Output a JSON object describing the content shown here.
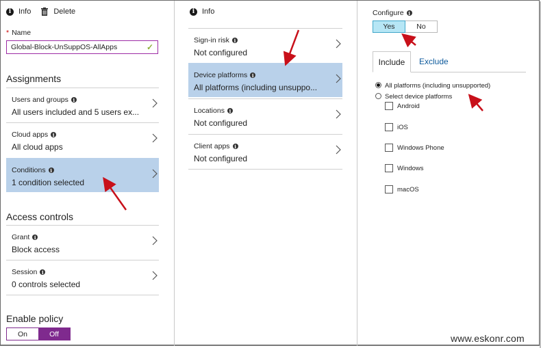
{
  "left_panel": {
    "toolbar": {
      "info_label": "Info",
      "delete_label": "Delete"
    },
    "name_label": "Name",
    "name_value": "Global-Block-UnSuppOS-AllApps",
    "assignments_heading": "Assignments",
    "assignments": [
      {
        "title": "Users and groups",
        "value": "All users included and 5 users ex..."
      },
      {
        "title": "Cloud apps",
        "value": "All cloud apps"
      },
      {
        "title": "Conditions",
        "value": "1 condition selected"
      }
    ],
    "access_heading": "Access controls",
    "access": [
      {
        "title": "Grant",
        "value": "Block access"
      },
      {
        "title": "Session",
        "value": "0 controls selected"
      }
    ],
    "enable_heading": "Enable policy",
    "toggle_on": "On",
    "toggle_off": "Off"
  },
  "middle_panel": {
    "toolbar": {
      "info_label": "Info"
    },
    "conditions": [
      {
        "title": "Sign-in risk",
        "value": "Not configured"
      },
      {
        "title": "Device platforms",
        "value": "All platforms (including unsuppo..."
      },
      {
        "title": "Locations",
        "value": "Not configured"
      },
      {
        "title": "Client apps",
        "value": "Not configured"
      }
    ]
  },
  "right_panel": {
    "configure_label": "Configure",
    "yes_label": "Yes",
    "no_label": "No",
    "tab_include": "Include",
    "tab_exclude": "Exclude",
    "radio_all": "All platforms (including unsupported)",
    "radio_select": "Select device platforms",
    "platforms": [
      "Android",
      "iOS",
      "Windows Phone",
      "Windows",
      "macOS"
    ]
  },
  "watermark": "www.eskonr.com",
  "colors": {
    "selected_row": "#b9d1ea",
    "toggle_purple": "#7f2a8e",
    "yes_blue": "#b6e6f5",
    "link": "#0d5a9c",
    "arrow_red": "#c8101a"
  }
}
